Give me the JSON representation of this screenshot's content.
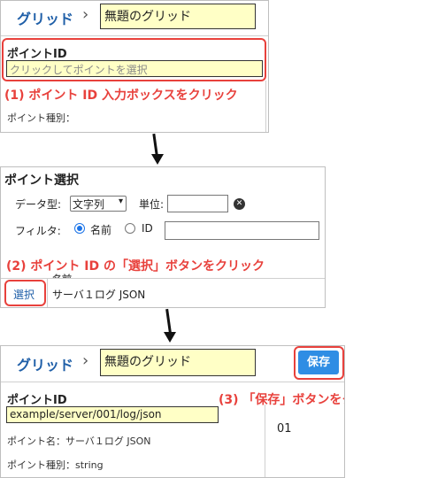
{
  "step1": {
    "grid_label": "グリッド",
    "grid_name": "無題のグリッド",
    "point_id_label": "ポイントID",
    "point_id_placeholder": "クリックしてポイントを選択",
    "note": "(1) ポイント ID 入力ボックスをクリック",
    "point_type_label": "ポイント種別："
  },
  "step2": {
    "title": "ポイント選択",
    "data_type_label": "データ型:",
    "data_type_value": "文字列",
    "unit_label": "単位:",
    "filter_label": "フィルタ:",
    "radio_name_label": "名前",
    "radio_id_label": "ID",
    "note": "(2) ポイント ID の「選択」ボタンをクリック",
    "column_header": "名前",
    "select_button": "選択",
    "row_name": "サーバ１ログ JSON"
  },
  "step3": {
    "grid_label": "グリッド",
    "grid_name": "無題のグリッド",
    "save_button": "保存",
    "note": "(3) 「保存」ボタンをクリック",
    "point_id_label": "ポイントID",
    "point_id_value": "example/server/001/log/json",
    "point_name_text": "ポイント名：サーバ１ログ JSON",
    "point_type_text": "ポイント種別：string",
    "cell_value": "01"
  },
  "colors": {
    "accent": "#1f5fa8",
    "highlight_red": "#e8413c",
    "input_yellow": "#ffffc6",
    "save_blue": "#2f8de4"
  }
}
